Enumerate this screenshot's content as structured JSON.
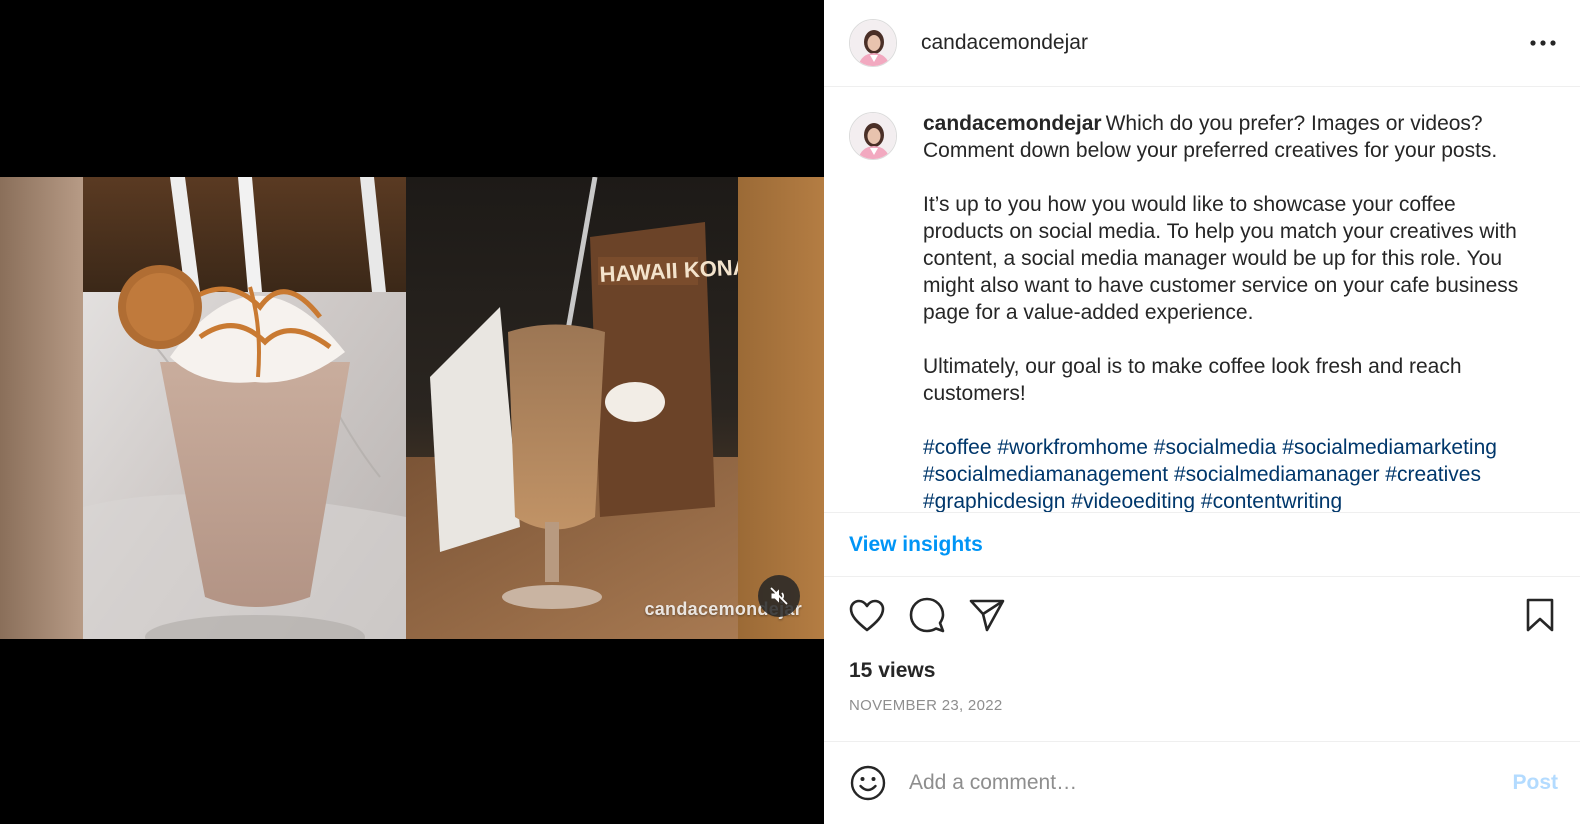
{
  "post": {
    "username": "candacemondejar",
    "watermark": "candacemondejar",
    "caption": {
      "username": "candacemondejar",
      "line1": "Which do you prefer? Images or videos? Comment down below your preferred creatives for your posts.",
      "paragraph2": "It’s up to you how you would like to showcase your coffee products on social media. To help you match your creatives with content, a social media manager would be up for this role. You might also want to have customer service on your cafe business page for a value-added experience.",
      "paragraph3": "Ultimately, our goal is to make coffee look fresh and reach customers!",
      "hashtags": [
        "#coffee",
        "#workfromhome",
        "#socialmedia",
        "#socialmediamarketing",
        "#socialmediamanagement",
        "#socialmediamanager",
        "#creatives",
        "#graphicdesign",
        "#videoediting",
        "#contentwriting"
      ]
    },
    "insights_label": "View insights",
    "views": "15 views",
    "date": "NOVEMBER 23, 2022"
  },
  "comment": {
    "placeholder": "Add a comment…",
    "post_label": "Post"
  },
  "icons": {
    "more": "more-horizontal-icon",
    "like": "heart-icon",
    "comment": "comment-icon",
    "share": "paper-plane-icon",
    "save": "bookmark-icon",
    "emoji": "emoji-icon",
    "mute": "muted-speaker-icon"
  },
  "colors": {
    "link_blue": "#0095f6",
    "hashtag": "#00376b",
    "post_disabled": "#b3dbff",
    "secondary_text": "#8e8e8e"
  }
}
